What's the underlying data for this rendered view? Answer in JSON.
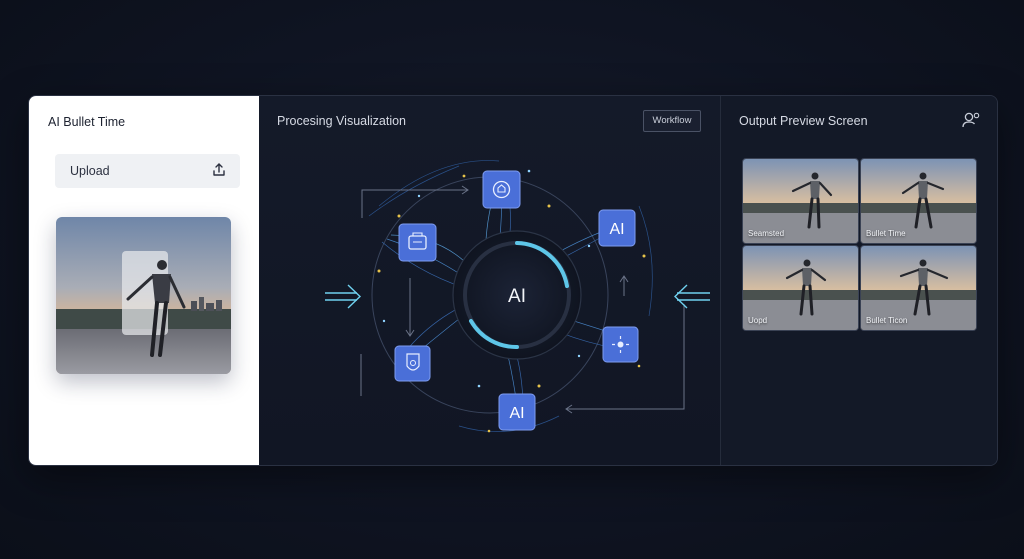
{
  "left_panel": {
    "title": "AI Bullet Time",
    "upload_label": "Upload",
    "upload_icon": "upload-icon"
  },
  "middle_panel": {
    "title": "Procesing Visualization",
    "workflow_button": "Workflow",
    "center_label": "AI",
    "node_labels": [
      "AI",
      "AI"
    ],
    "accent_color": "#5ec6e8",
    "node_color": "#4a6fd8"
  },
  "right_panel": {
    "title": "Output Preview Screen",
    "user_icon": "user-settings-icon",
    "thumbnails": [
      {
        "caption": "Seamsted"
      },
      {
        "caption": "Bullet Time"
      },
      {
        "caption": "Uopd"
      },
      {
        "caption": "Bullet Ticon"
      }
    ]
  }
}
